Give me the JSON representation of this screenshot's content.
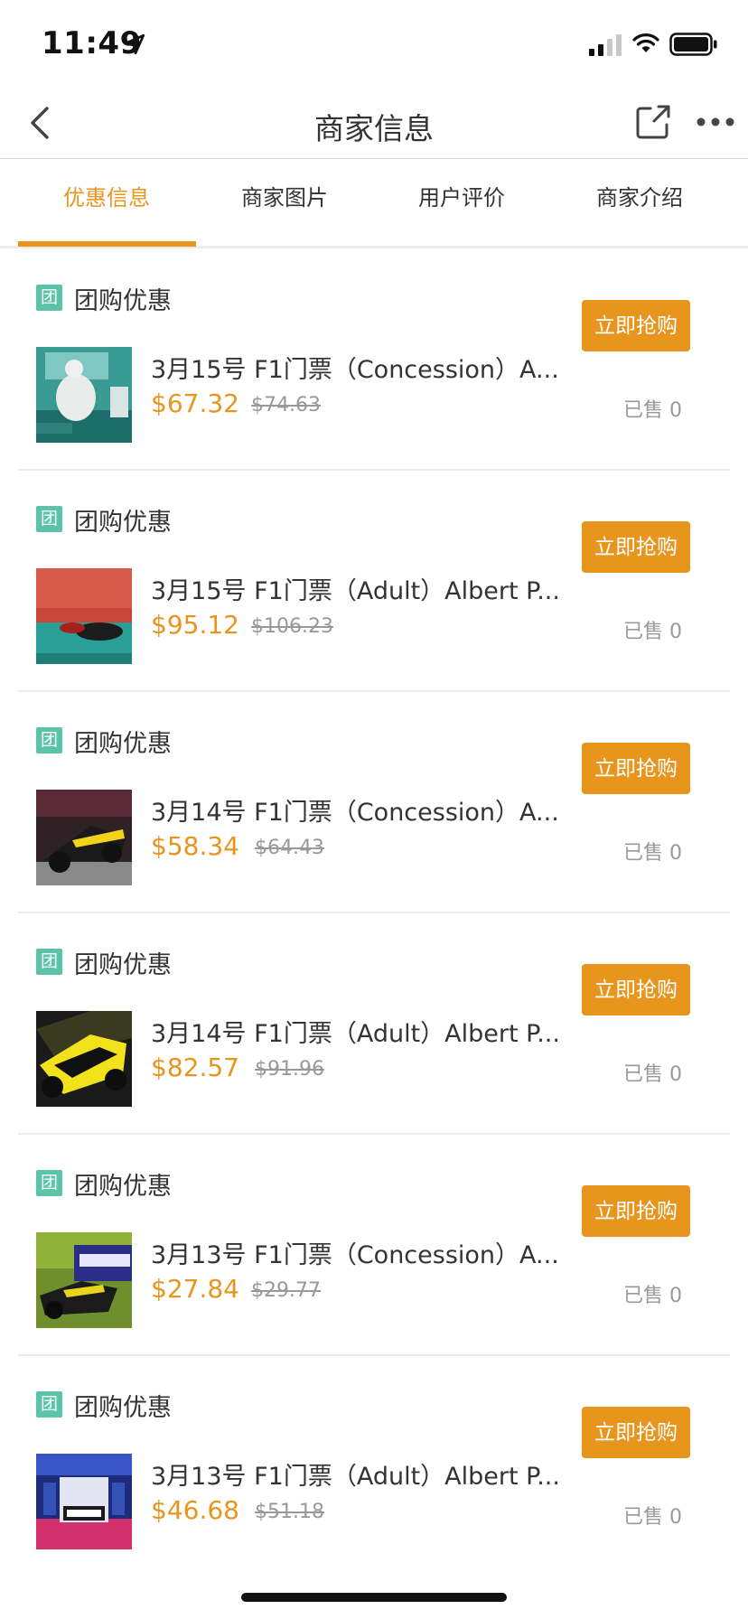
{
  "status_bar": {
    "time": "11:49"
  },
  "nav": {
    "title": "商家信息"
  },
  "tabs": [
    {
      "label": "优惠信息",
      "active": true
    },
    {
      "label": "商家图片",
      "active": false
    },
    {
      "label": "用户评价",
      "active": false
    },
    {
      "label": "商家介绍",
      "active": false
    }
  ],
  "colors": {
    "accent": "#e8951e",
    "tuan_badge": "#5bc4a8"
  },
  "deals": [
    {
      "badge": "团",
      "tag": "团购优惠",
      "title": "3月15号 F1门票（Concession）A...",
      "price": "$67.32",
      "original_price": "$74.63",
      "button": "立即抢购",
      "sold": "已售 0"
    },
    {
      "badge": "团",
      "tag": "团购优惠",
      "title": "3月15号 F1门票（Adult）Albert P...",
      "price": "$95.12",
      "original_price": "$106.23",
      "button": "立即抢购",
      "sold": "已售 0"
    },
    {
      "badge": "团",
      "tag": "团购优惠",
      "title": "3月14号 F1门票（Concession）A...",
      "price": "$58.34",
      "original_price": "$64.43",
      "button": "立即抢购",
      "sold": "已售 0"
    },
    {
      "badge": "团",
      "tag": "团购优惠",
      "title": "3月14号 F1门票（Adult）Albert P...",
      "price": "$82.57",
      "original_price": "$91.96",
      "button": "立即抢购",
      "sold": "已售 0"
    },
    {
      "badge": "团",
      "tag": "团购优惠",
      "title": "3月13号 F1门票（Concession）A...",
      "price": "$27.84",
      "original_price": "$29.77",
      "button": "立即抢购",
      "sold": "已售 0"
    },
    {
      "badge": "团",
      "tag": "团购优惠",
      "title": "3月13号 F1门票（Adult）Albert P...",
      "price": "$46.68",
      "original_price": "$51.18",
      "button": "立即抢购",
      "sold": "已售 0"
    }
  ]
}
